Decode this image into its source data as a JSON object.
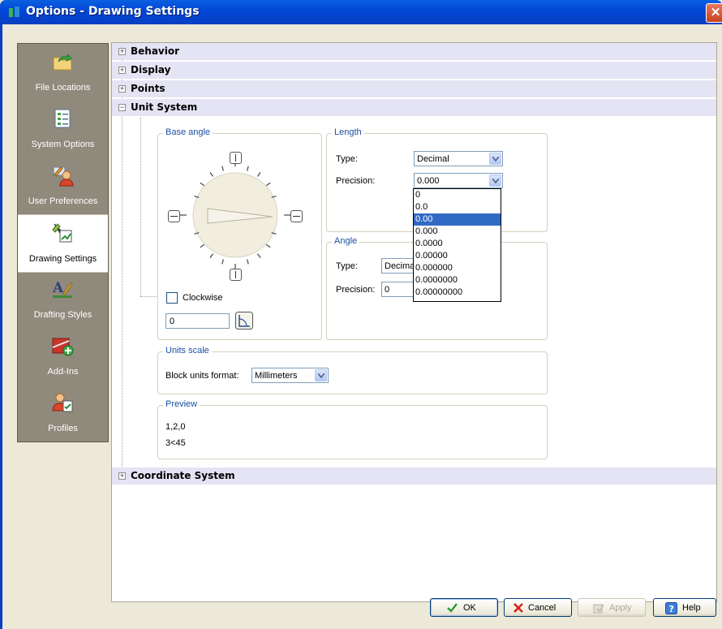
{
  "window": {
    "title": "Options - Drawing Settings",
    "close_glyph": "✕"
  },
  "sidebar": {
    "items": [
      {
        "label": "File Locations",
        "icon": "folder-arrow-icon"
      },
      {
        "label": "System Options",
        "icon": "checklist-icon"
      },
      {
        "label": "User Preferences",
        "icon": "user-pencil-icon"
      },
      {
        "label": "Drawing Settings",
        "icon": "drawing-settings-icon",
        "active": true
      },
      {
        "label": "Drafting Styles",
        "icon": "drafting-styles-icon"
      },
      {
        "label": "Add-Ins",
        "icon": "add-ins-icon"
      },
      {
        "label": "Profiles",
        "icon": "profiles-icon"
      }
    ]
  },
  "tree": {
    "behavior": "Behavior",
    "display": "Display",
    "points": "Points",
    "unit_system": "Unit System",
    "coordinate_system": "Coordinate System",
    "collapsed_glyph": "+",
    "expanded_glyph": "−"
  },
  "base_angle": {
    "legend": "Base angle",
    "clockwise_label": "Clockwise",
    "clockwise_checked": false,
    "value": "0"
  },
  "length": {
    "legend": "Length",
    "type_label": "Type:",
    "type_value": "Decimal",
    "precision_label": "Precision:",
    "precision_value": "0.000",
    "precision_options": [
      "0",
      "0.0",
      "0.00",
      "0.000",
      "0.0000",
      "0.00000",
      "0.000000",
      "0.0000000",
      "0.00000000"
    ],
    "highlighted_option": "0.00"
  },
  "angle": {
    "legend": "Angle",
    "type_label": "Type:",
    "type_value": "Decima",
    "precision_label": "Precision:",
    "precision_value": "0"
  },
  "units_scale": {
    "legend": "Units scale",
    "block_units_label": "Block units format:",
    "block_units_value": "Millimeters"
  },
  "preview": {
    "legend": "Preview",
    "line1": "1,2,0",
    "line2": "3<45"
  },
  "buttons": {
    "ok": "OK",
    "cancel": "Cancel",
    "apply": "Apply",
    "help": "Help"
  },
  "colors": {
    "titlebar": "#0046d5",
    "sidebar": "#8f8a7c",
    "tree_row": "#e4e4f4",
    "legend_text": "#1a4fa0",
    "selection": "#316ac5"
  }
}
